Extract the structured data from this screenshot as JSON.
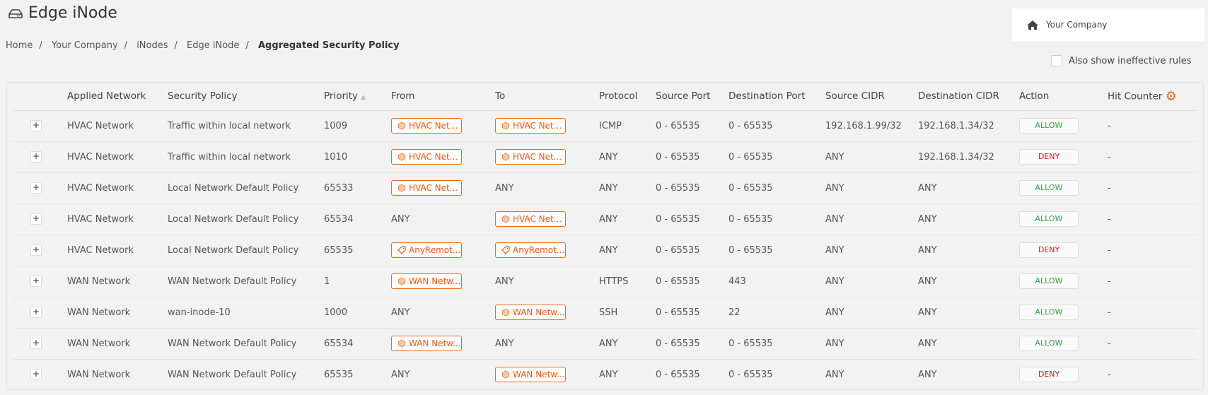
{
  "header": {
    "title": "Edge iNode",
    "icon": "hard-drive-icon"
  },
  "breadcrumb": [
    "Home",
    "Your Company",
    "iNodes",
    "Edge iNode",
    "Aggregated Security Policy"
  ],
  "company_box": {
    "label": "Your Company",
    "icon": "home-icon"
  },
  "checkbox": {
    "label": "Also show ineffective rules",
    "checked": false
  },
  "table": {
    "columns": [
      "Applied Network",
      "Security Policy",
      "Priority",
      "From",
      "To",
      "Protocol",
      "Source Port",
      "Destination Port",
      "Source CIDR",
      "Destination CIDR",
      "Action",
      "Hit Counter"
    ],
    "rows": [
      {
        "network": "HVAC Network",
        "policy": "Traffic within local network",
        "priority": "1009",
        "from": {
          "tag": true,
          "icon": "network-icon",
          "text": "HVAC Net..."
        },
        "to": {
          "tag": true,
          "icon": "network-icon",
          "text": "HVAC Net..."
        },
        "protocol": "ICMP",
        "sport": "0 - 65535",
        "dport": "0 - 65535",
        "scidr": "192.168.1.99/32",
        "dcidr": "192.168.1.34/32",
        "action": "ALLOW",
        "hits": "-"
      },
      {
        "network": "HVAC Network",
        "policy": "Traffic within local network",
        "priority": "1010",
        "from": {
          "tag": true,
          "icon": "network-icon",
          "text": "HVAC Net..."
        },
        "to": {
          "tag": true,
          "icon": "network-icon",
          "text": "HVAC Net..."
        },
        "protocol": "ANY",
        "sport": "0 - 65535",
        "dport": "0 - 65535",
        "scidr": "ANY",
        "dcidr": "192.168.1.34/32",
        "action": "DENY",
        "hits": "-"
      },
      {
        "network": "HVAC Network",
        "policy": "Local Network Default Policy",
        "priority": "65533",
        "from": {
          "tag": true,
          "icon": "network-icon",
          "text": "HVAC Net..."
        },
        "to": {
          "tag": false,
          "text": "ANY"
        },
        "protocol": "ANY",
        "sport": "0 - 65535",
        "dport": "0 - 65535",
        "scidr": "ANY",
        "dcidr": "ANY",
        "action": "ALLOW",
        "hits": "-"
      },
      {
        "network": "HVAC Network",
        "policy": "Local Network Default Policy",
        "priority": "65534",
        "from": {
          "tag": false,
          "text": "ANY"
        },
        "to": {
          "tag": true,
          "icon": "network-icon",
          "text": "HVAC Net..."
        },
        "protocol": "ANY",
        "sport": "0 - 65535",
        "dport": "0 - 65535",
        "scidr": "ANY",
        "dcidr": "ANY",
        "action": "ALLOW",
        "hits": "-"
      },
      {
        "network": "HVAC Network",
        "policy": "Local Network Default Policy",
        "priority": "65535",
        "from": {
          "tag": true,
          "icon": "tag-icon",
          "text": "AnyRemot..."
        },
        "to": {
          "tag": true,
          "icon": "tag-icon",
          "text": "AnyRemot..."
        },
        "protocol": "ANY",
        "sport": "0 - 65535",
        "dport": "0 - 65535",
        "scidr": "ANY",
        "dcidr": "ANY",
        "action": "DENY",
        "hits": "-"
      },
      {
        "network": "WAN Network",
        "policy": "WAN Network Default Policy",
        "priority": "1",
        "from": {
          "tag": true,
          "icon": "network-icon",
          "text": "WAN Netw..."
        },
        "to": {
          "tag": false,
          "text": "ANY"
        },
        "protocol": "HTTPS",
        "sport": "0 - 65535",
        "dport": "443",
        "scidr": "ANY",
        "dcidr": "ANY",
        "action": "ALLOW",
        "hits": "-"
      },
      {
        "network": "WAN Network",
        "policy": "wan-inode-10",
        "priority": "1000",
        "from": {
          "tag": false,
          "text": "ANY"
        },
        "to": {
          "tag": true,
          "icon": "network-icon",
          "text": "WAN Netw..."
        },
        "protocol": "SSH",
        "sport": "0 - 65535",
        "dport": "22",
        "scidr": "ANY",
        "dcidr": "ANY",
        "action": "ALLOW",
        "hits": "-"
      },
      {
        "network": "WAN Network",
        "policy": "WAN Network Default Policy",
        "priority": "65534",
        "from": {
          "tag": true,
          "icon": "network-icon",
          "text": "WAN Netw..."
        },
        "to": {
          "tag": false,
          "text": "ANY"
        },
        "protocol": "ANY",
        "sport": "0 - 65535",
        "dport": "0 - 65535",
        "scidr": "ANY",
        "dcidr": "ANY",
        "action": "ALLOW",
        "hits": "-"
      },
      {
        "network": "WAN Network",
        "policy": "WAN Network Default Policy",
        "priority": "65535",
        "from": {
          "tag": false,
          "text": "ANY"
        },
        "to": {
          "tag": true,
          "icon": "network-icon",
          "text": "WAN Netw..."
        },
        "protocol": "ANY",
        "sport": "0 - 65535",
        "dport": "0 - 65535",
        "scidr": "ANY",
        "dcidr": "ANY",
        "action": "DENY",
        "hits": "-"
      }
    ]
  },
  "colors": {
    "accent": "#ee6a12",
    "allow": "#2aa84a",
    "deny": "#e8141e"
  }
}
